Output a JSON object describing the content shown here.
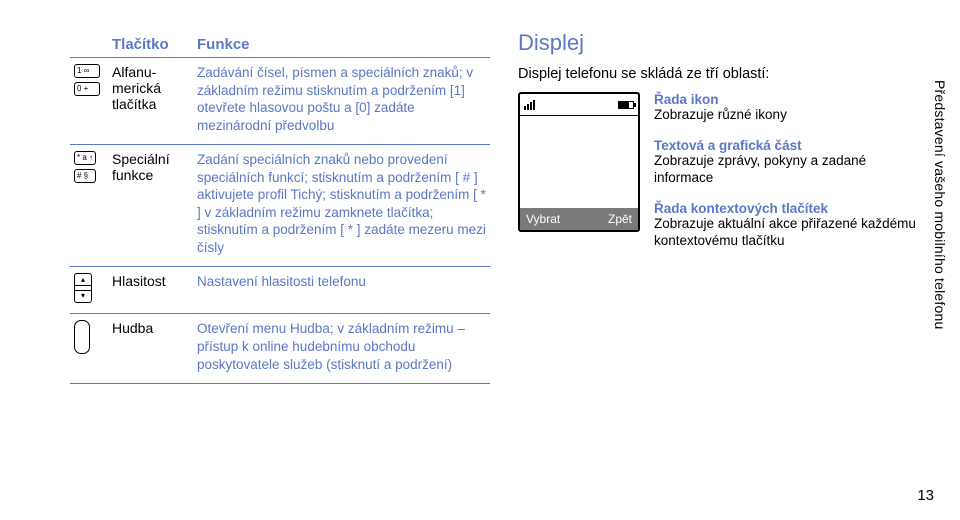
{
  "table": {
    "headers": {
      "col1": "Tlačítko",
      "col2": "Funkce"
    },
    "rows": [
      {
        "label": "Alfanu­merická tlačítka",
        "desc": "Zadávání čísel, písmen a speciálních znaků; v základním režimu stisknutím a podržením [1] otevřete hlasovou poštu a [0] zadáte mezinárodní předvolbu"
      },
      {
        "label": "Speciální funkce",
        "desc": "Zadání speciálních znaků nebo provedení speciálních funkcí; stisknutím a podržením [ # ] aktivujete profil Tichý; stisknutím a podržením [ * ] v základním režimu zamknete tlačítka; stisknutím a podržením [ * ] zadáte mezeru mezi čísly"
      },
      {
        "label": "Hlasitost",
        "desc": "Nastavení hlasitosti telefonu"
      },
      {
        "label": "Hudba",
        "desc": "Otevření menu Hudba; v základním režimu – přístup k online hudebnímu obchodu poskytovatele služeb (stisknutí a podržení)"
      }
    ]
  },
  "display": {
    "title": "Displej",
    "intro": "Displej telefonu se skládá ze tří oblastí:",
    "screen": {
      "softleft": "Vybrat",
      "softright": "Zpět"
    },
    "labels": [
      {
        "title": "Řada ikon",
        "desc": "Zobrazuje různé ikony"
      },
      {
        "title": "Textová a grafická část",
        "desc": "Zobrazuje zprávy, pokyny a zadané informace"
      },
      {
        "title": "Řada kontextových tlačítek",
        "desc": "Zobrazuje aktuální akce přiřazené každému kontextovému tlačítku"
      }
    ]
  },
  "sidetab": "Představení vašeho mobilního telefonu",
  "page": "13"
}
